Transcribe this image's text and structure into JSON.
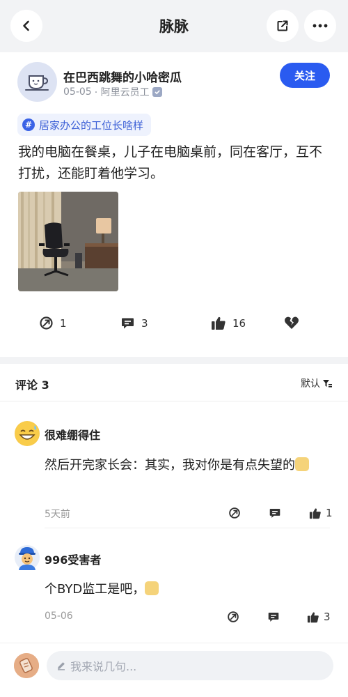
{
  "header": {
    "title": "脉脉",
    "icons": [
      "back-arrow-icon",
      "share-icon",
      "more-icon"
    ]
  },
  "post": {
    "author": "在巴西跳舞的小哈密瓜",
    "date": "05-05",
    "company": "· 阿里云员工",
    "follow_label": "关注",
    "topic": "居家办公的工位长啥样",
    "text": "我的电脑在餐桌，儿子在电脑桌前，同在客厅，互不打扰，还能盯着他学习。",
    "actions": {
      "reposts": "1",
      "comments": "3",
      "likes": "16"
    }
  },
  "comments_section": {
    "title": "评论 3",
    "sort_label": "默认",
    "items": [
      {
        "name": "很难绷得住",
        "text": "然后开完家长会：其实，我对你是有点失望的",
        "time": "5天前",
        "likes": "1"
      },
      {
        "name": "996受害者",
        "text": "个BYD监工是吧，",
        "time": "05-06",
        "likes": "3"
      }
    ]
  },
  "composer": {
    "placeholder": "我来说几句..."
  },
  "colors": {
    "accent": "#2a5bf0",
    "topic_text": "#3b5fd6",
    "topic_bg": "#eef2fd",
    "band": "#f2f3f5"
  }
}
